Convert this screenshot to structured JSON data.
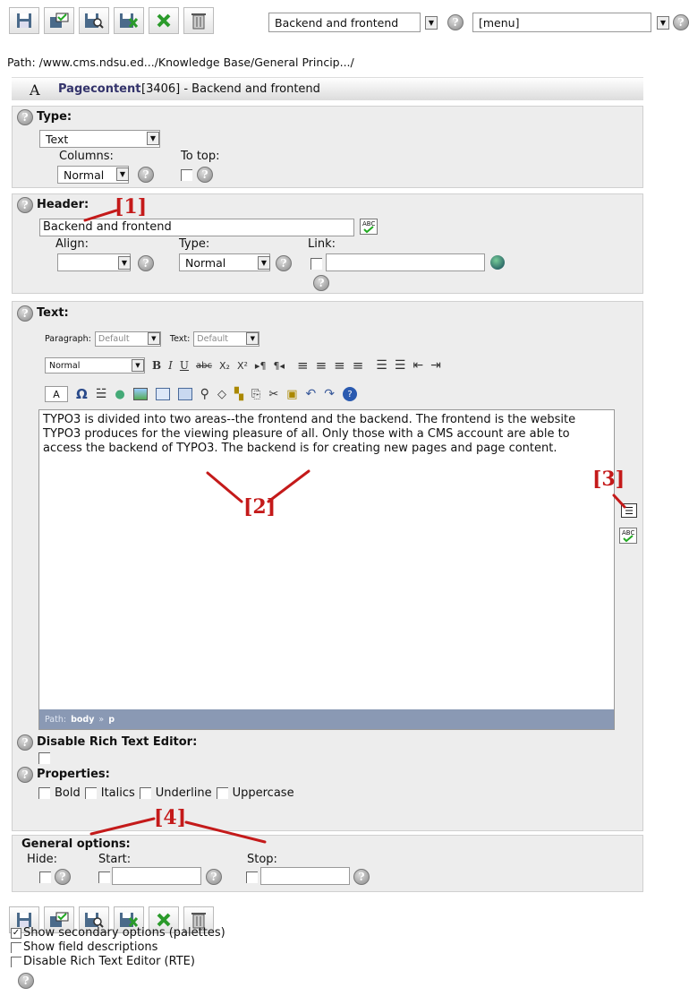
{
  "toolbar": {
    "icons": [
      "save-icon",
      "save-spellcheck-icon",
      "save-view-icon",
      "save-close-icon",
      "close-icon",
      "delete-icon"
    ],
    "language": "Backend and frontend",
    "menu": "[menu]"
  },
  "path": "Path: /www.cms.ndsu.ed.../Knowledge Base/General Princip.../",
  "record": {
    "prefix": "A",
    "type": "Pagecontent",
    "id": "[3406] - Backend and frontend"
  },
  "type_section": {
    "label": "Type:",
    "value": "Text",
    "columns_label": "Columns:",
    "columns_value": "Normal",
    "totop_label": "To top:"
  },
  "header_section": {
    "label": "Header:",
    "value": "Backend and frontend",
    "align_label": "Align:",
    "type_label": "Type:",
    "type_value": "Normal",
    "link_label": "Link:"
  },
  "text_section": {
    "label": "Text:",
    "paragraph_label": "Paragraph:",
    "paragraph_value": "Default",
    "text_label": "Text:",
    "text_value": "Default",
    "block_style": "Normal",
    "body": "TYPO3 is divided into two areas--the frontend and the backend.  The frontend is the website TYPO3 produces for the viewing pleasure of all.  Only those with a CMS account are able to access the backend of TYPO3.  The backend is for creating new pages and page content.",
    "statusbar_path": "Path:",
    "statusbar_body": "body",
    "statusbar_sep": "»",
    "statusbar_p": "p"
  },
  "disable_rte_label": "Disable Rich Text Editor:",
  "properties": {
    "label": "Properties:",
    "options": [
      "Bold",
      "Italics",
      "Underline",
      "Uppercase"
    ]
  },
  "general_options": {
    "label": "General options:",
    "hide_label": "Hide:",
    "start_label": "Start:",
    "stop_label": "Stop:"
  },
  "bottom_options": [
    "Show secondary options (palettes)",
    "Show field descriptions",
    "Disable Rich Text Editor (RTE)"
  ],
  "annotations": [
    "[1]",
    "[2]",
    "[3]",
    "[4]"
  ],
  "rte_row2": [
    "B",
    "I",
    "U",
    "abc",
    "X₂",
    "X²",
    "▸¶",
    "¶◂"
  ],
  "font_chip": "A"
}
